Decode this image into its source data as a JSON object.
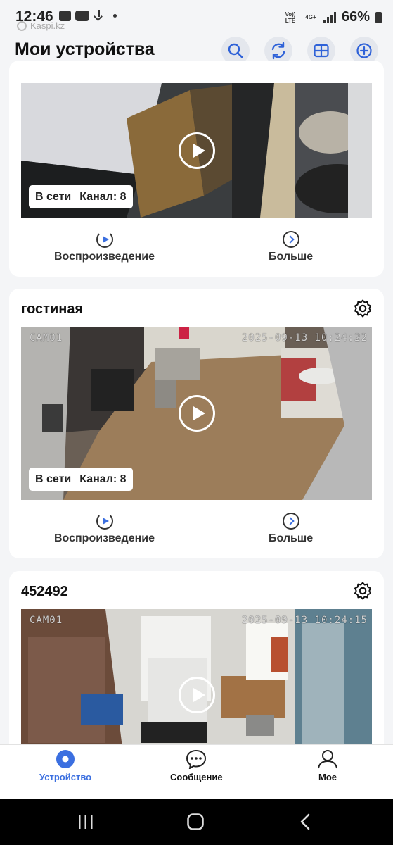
{
  "status_bar": {
    "time": "12:46",
    "carrier_note": "Kaspi.kz",
    "network_1": "Vo)) LTE",
    "network_2": "4G+",
    "battery": "66%"
  },
  "header": {
    "title": "Мои устройства",
    "icons": [
      "search-icon",
      "refresh-icon",
      "grid-layout-icon",
      "add-icon"
    ]
  },
  "devices": [
    {
      "name": "",
      "online": "В сети",
      "channel": "Канал: 8",
      "playback_label": "Воспроизведение",
      "more_label": "Больше"
    },
    {
      "name": "гостиная",
      "cam_label": "CAM01",
      "timestamp": "2025-09-13 10:24:22",
      "online": "В сети",
      "channel": "Канал: 8",
      "playback_label": "Воспроизведение",
      "more_label": "Больше"
    },
    {
      "name": "452492",
      "cam_label": "CAM01",
      "timestamp": "2025-09-13 10:24:15"
    }
  ],
  "bottom_nav": {
    "items": [
      {
        "label": "Устройство",
        "icon": "device-icon",
        "active": true
      },
      {
        "label": "Сообщение",
        "icon": "message-icon",
        "active": false
      },
      {
        "label": "Мое",
        "icon": "profile-icon",
        "active": false
      }
    ]
  },
  "colors": {
    "accent": "#3b6fe0",
    "background": "#f4f5f7",
    "card": "#ffffff"
  }
}
